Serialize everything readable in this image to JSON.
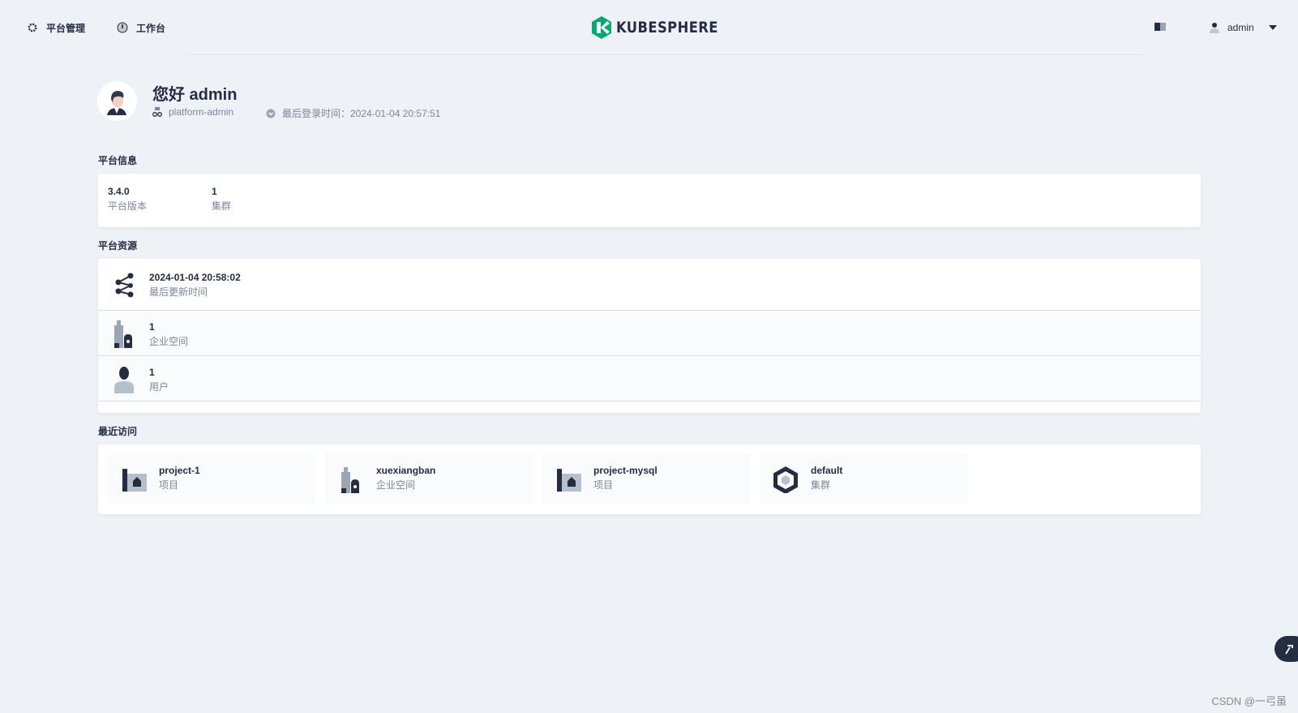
{
  "nav": {
    "platform_label": "平台管理",
    "workbench_label": "工作台",
    "logo_text": "KUBESPHERE",
    "username": "admin"
  },
  "profile": {
    "greeting": "您好 admin",
    "role": "platform-admin",
    "last_login": "最后登录时间：2024-01-04 20:57:51"
  },
  "platform_info": {
    "title": "平台信息",
    "items": [
      {
        "value": "3.4.0",
        "label": "平台版本"
      },
      {
        "value": "1",
        "label": "集群"
      }
    ]
  },
  "platform_resources": {
    "title": "平台资源",
    "rows": [
      {
        "value": "2024-01-04 20:58:02",
        "label": "最后更新时间",
        "icon": "share-icon"
      },
      {
        "value": "1",
        "label": "企业空间",
        "icon": "workspace-icon"
      },
      {
        "value": "1",
        "label": "用户",
        "icon": "user-icon"
      }
    ]
  },
  "recent": {
    "title": "最近访问",
    "items": [
      {
        "name": "project-1",
        "type": "项目",
        "icon": "project-icon"
      },
      {
        "name": "xuexiangban",
        "type": "企业空间",
        "icon": "workspace-icon"
      },
      {
        "name": "project-mysql",
        "type": "项目",
        "icon": "project-icon"
      },
      {
        "name": "default",
        "type": "集群",
        "icon": "cluster-icon"
      }
    ]
  },
  "watermark": "CSDN @一弓虽",
  "colors": {
    "background": "#eef2f6",
    "text_primary": "#242e42",
    "text_secondary": "#79879c",
    "brand_green": "#00aa72"
  }
}
